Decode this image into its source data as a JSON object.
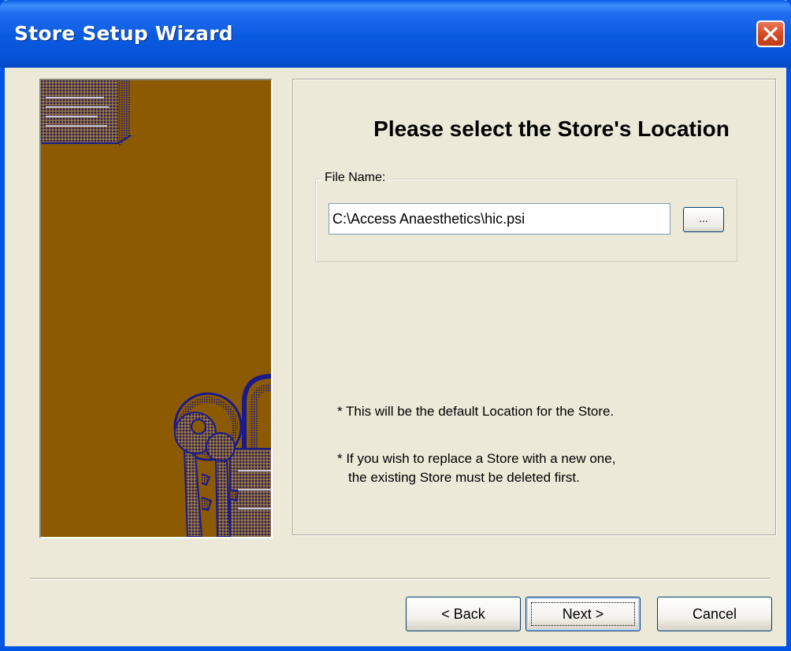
{
  "window": {
    "title": "Store Setup Wizard",
    "close_icon": "close-icon"
  },
  "main": {
    "heading": "Please select the Store's Location",
    "file_group": {
      "legend": "File Name:",
      "value": "C:\\Access Anaesthetics\\hic.psi",
      "browse_label": "..."
    },
    "notes": [
      "* This will be the default Location for the Store.",
      "*  If you wish to replace a Store with a new one,",
      "the existing Store must be deleted first."
    ]
  },
  "art": {
    "icon": "keys-and-padlock-icon",
    "background_color": "#8c5a00"
  },
  "footer": {
    "back_label": "< Back",
    "next_label": "Next >",
    "cancel_label": "Cancel"
  },
  "colors": {
    "title_bar": "#0a5ae0",
    "window_bg": "#ece9d8",
    "close_button": "#d4471f"
  }
}
